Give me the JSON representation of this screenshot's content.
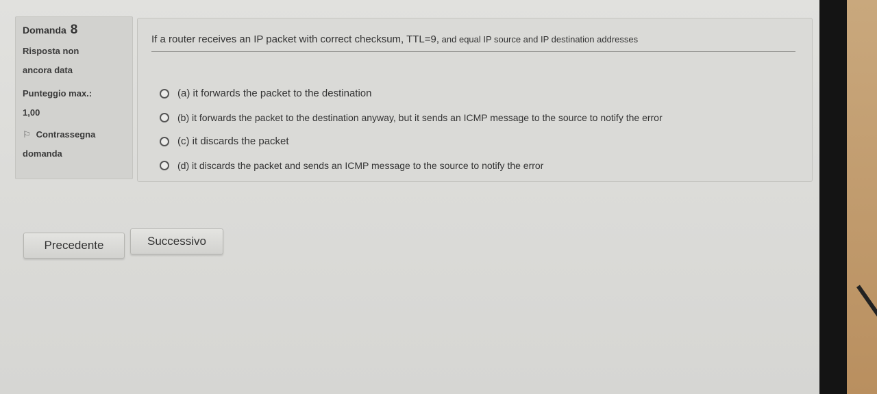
{
  "info": {
    "label": "Domanda",
    "number": "8",
    "status_line1": "Risposta non",
    "status_line2": "ancora data",
    "points_line1": "Punteggio max.:",
    "points_line2": "1,00",
    "flag_label_line1": "Contrassegna",
    "flag_label_line2": "domanda"
  },
  "question": {
    "text_main": "If a router receives an IP packet with correct checksum, TTL=9,",
    "text_tail": " and equal IP source and IP destination addresses"
  },
  "options": [
    {
      "label": "(a) it forwards the packet to the destination"
    },
    {
      "label": "(b) it forwards the packet to the destination anyway, but it sends an ICMP message to the source to notify the error"
    },
    {
      "label": "(c) it discards the packet"
    },
    {
      "label": "(d) it discards the packet and sends an ICMP message to the source to notify the error"
    }
  ],
  "nav": {
    "prev_label": "Precedente",
    "next_label": "Successivo"
  }
}
